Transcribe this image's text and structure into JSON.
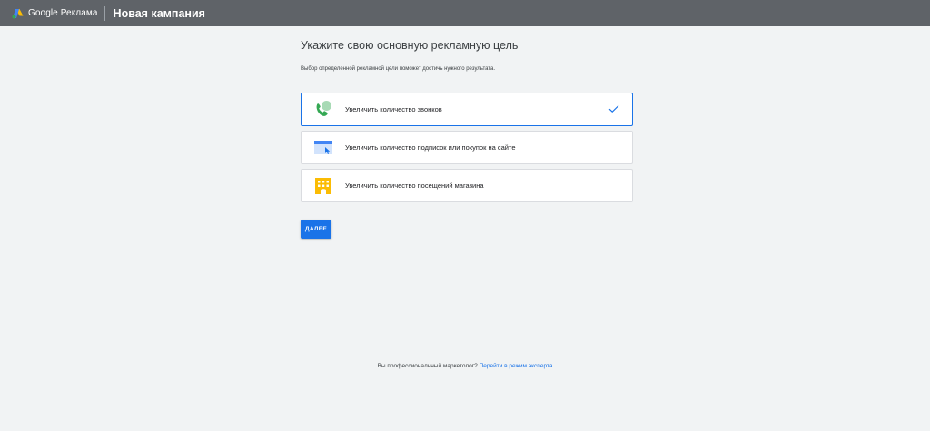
{
  "header": {
    "logo_text": "Google Реклама",
    "campaign_title": "Новая кампания"
  },
  "main": {
    "heading": "Укажите свою основную рекламную цель",
    "subtext": "Выбор определенной рекламной цели поможет достичь нужного результата.",
    "goals": [
      {
        "label": "Увеличить количество звонков",
        "icon": "phone-call-icon",
        "selected": true
      },
      {
        "label": "Увеличить количество подписок или покупок на сайте",
        "icon": "website-click-icon",
        "selected": false
      },
      {
        "label": "Увеличить количество посещений магазина",
        "icon": "store-icon",
        "selected": false
      }
    ],
    "next_label": "ДАЛЕЕ"
  },
  "footer": {
    "text": "Вы профессиональный маркетолог?",
    "link": "Перейти в режим эксперта"
  },
  "colors": {
    "accent": "#1a73e8",
    "topbar": "#5f6368",
    "background": "#f1f3f4"
  }
}
